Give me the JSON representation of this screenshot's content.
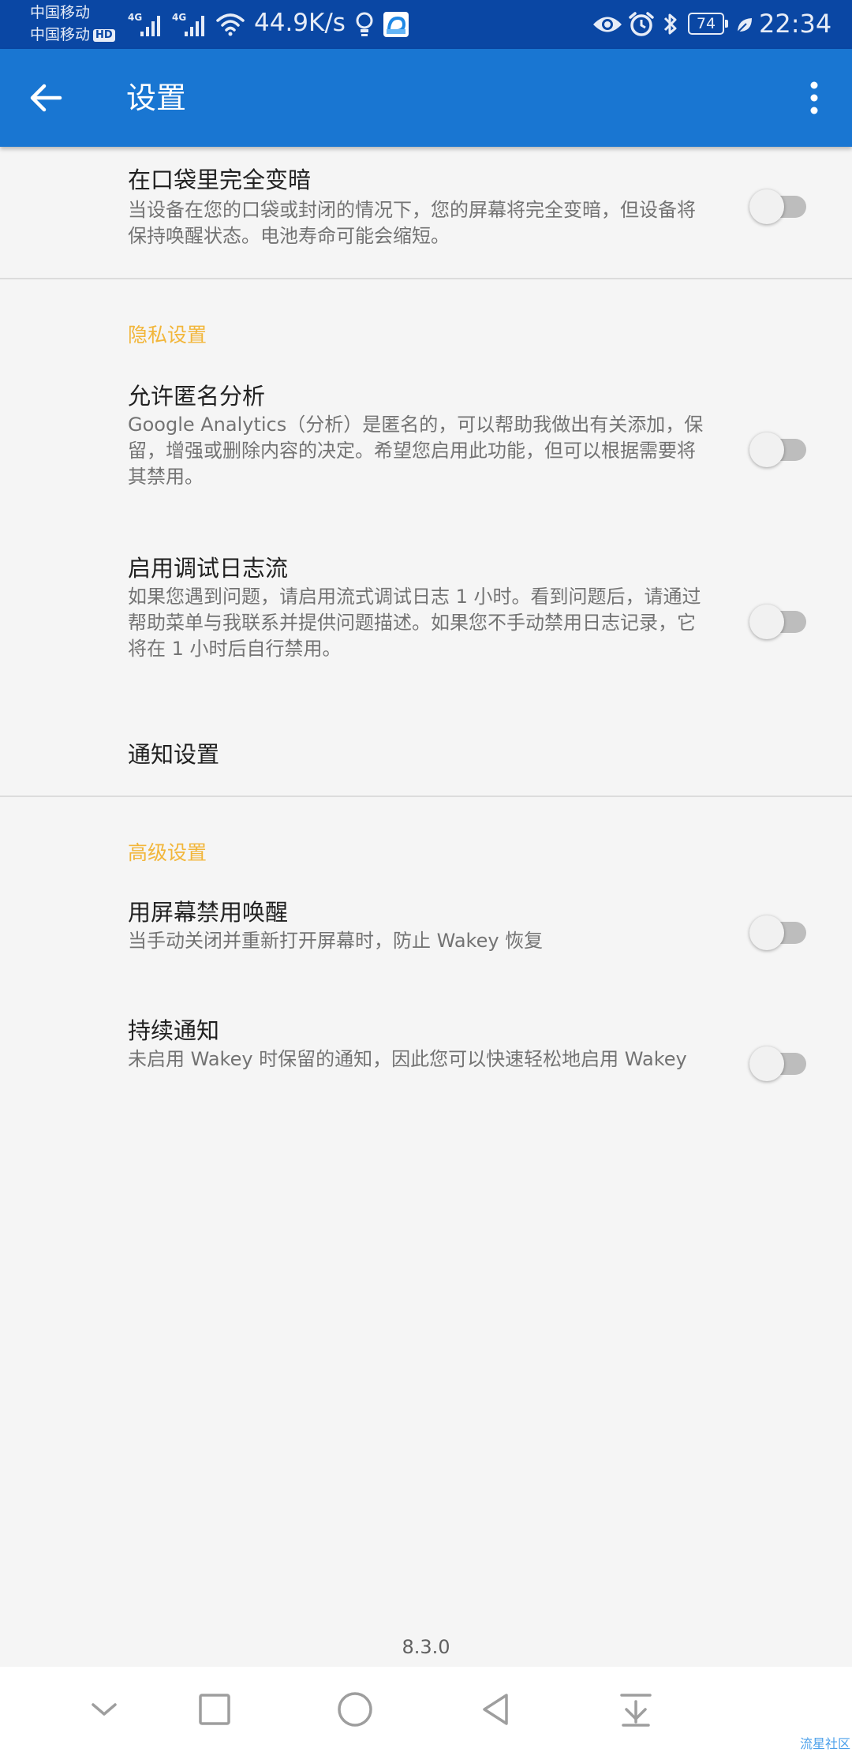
{
  "status_bar": {
    "carrier_1": "中国移动",
    "carrier_2": "中国移动",
    "hd_label": "HD",
    "net_speed": "44.9K/s",
    "battery_level": "74",
    "time": "22:34",
    "icons": [
      "signal-4g-icon",
      "signal-4g-icon",
      "wifi-icon",
      "bulb-icon",
      "app-notification-icon",
      "eye-icon",
      "alarm-icon",
      "bluetooth-icon",
      "battery-icon",
      "leaf-icon"
    ]
  },
  "app_bar": {
    "title": "设置",
    "color": "#1976d2"
  },
  "prefs": {
    "pocket_dark": {
      "title": "在口袋里完全变暗",
      "summary": "当设备在您的口袋或封闭的情况下，您的屏幕将完全变暗，但设备将保持唤醒状态。电池寿命可能会缩短。",
      "checked": false
    },
    "privacy_header": "隐私设置",
    "anonymous_analytics": {
      "title": "允许匿名分析",
      "summary": "Google Analytics（分析）是匿名的，可以帮助我做出有关添加，保留，增强或删除内容的决定。希望您启用此功能，但可以根据需要将其禁用。",
      "checked": false
    },
    "debug_log": {
      "title": "启用调试日志流",
      "summary": "如果您遇到问题，请启用流式调试日志 1 小时。看到问题后，请通过帮助菜单与我联系并提供问题描述。如果您不手动禁用日志记录，它将在 1 小时后自行禁用。",
      "checked": false
    },
    "notification_settings": {
      "title": "通知设置"
    },
    "advanced_header": "高级设置",
    "screen_disable": {
      "title": "用屏幕禁用唤醒",
      "summary": "当手动关闭并重新打开屏幕时，防止 Wakey 恢复",
      "checked": false
    },
    "persistent_notification": {
      "title": "持续通知",
      "summary": "未启用 Wakey 时保留的通知，因此您可以快速轻松地启用 Wakey",
      "checked": false
    }
  },
  "version": "8.3.0",
  "watermark": "流星社区",
  "colors": {
    "accent": "#f2b63a",
    "status_bar": "#0a47a4",
    "background": "#f5f5f5"
  }
}
